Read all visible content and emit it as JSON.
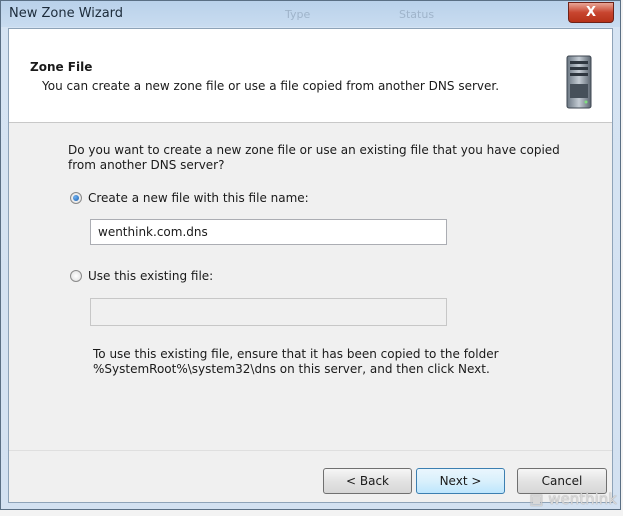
{
  "window": {
    "title": "New Zone Wizard",
    "ghost_labels": [
      "Type",
      "Status"
    ],
    "close_label": "X"
  },
  "header": {
    "title": "Zone File",
    "subtitle": "You can create a new zone file or use a file copied from another DNS server."
  },
  "body": {
    "question": "Do you want to create a new zone file or use an existing file that you have copied from another DNS server?",
    "option_new": {
      "label": "Create a new file with this file name:",
      "checked": true,
      "value": "wenthink.com.dns"
    },
    "option_existing": {
      "label": "Use this existing file:",
      "checked": false,
      "value": ""
    },
    "info": "To use this existing file, ensure that it has been copied to the folder %SystemRoot%\\system32\\dns on this server, and then click Next."
  },
  "buttons": {
    "back": "< Back",
    "next": "Next >",
    "cancel": "Cancel"
  },
  "watermark": "wenthink",
  "icons": {
    "server": "server-icon",
    "close": "close-icon"
  },
  "colors": {
    "accent": "#3c7fb1",
    "close": "#c8452f",
    "title_bar": "#c9dcf0"
  }
}
